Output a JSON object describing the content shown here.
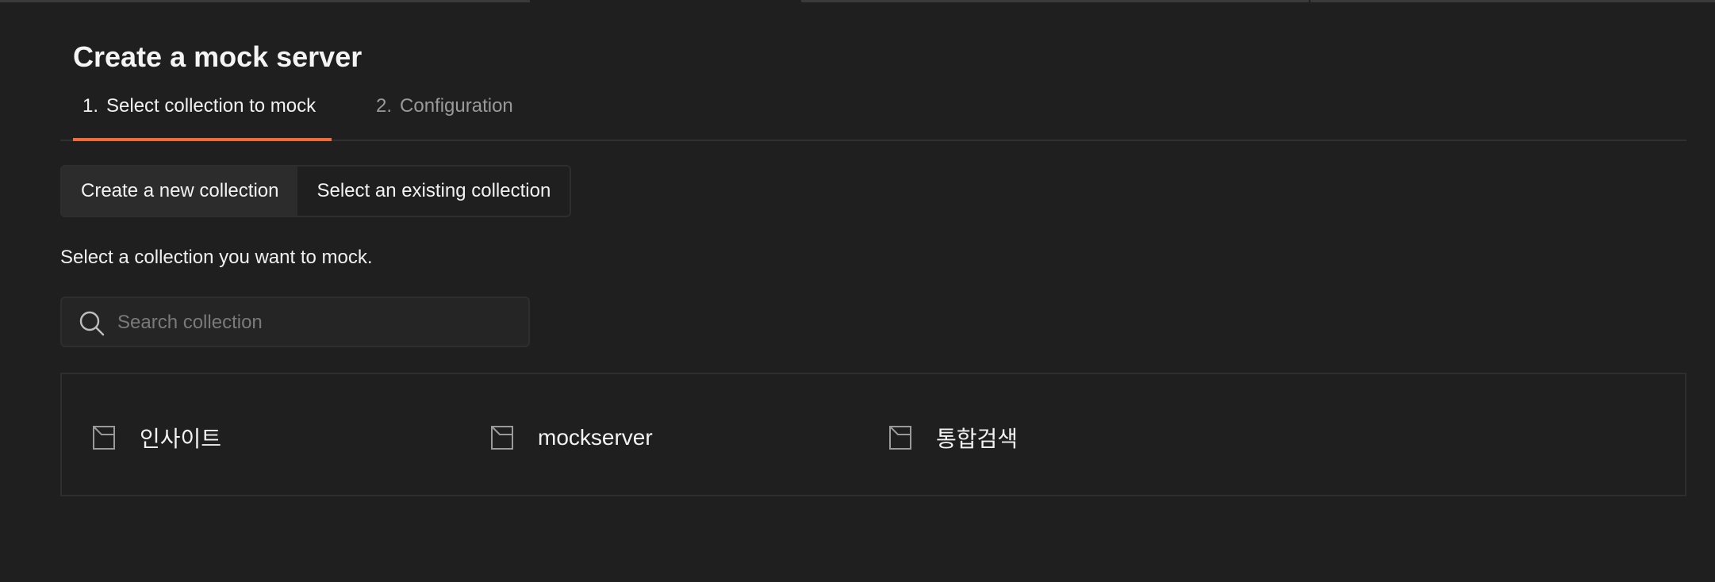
{
  "page": {
    "title": "Create a mock server"
  },
  "steps": [
    {
      "number": "1.",
      "label": "Select collection to mock",
      "active": true
    },
    {
      "number": "2.",
      "label": "Configuration",
      "active": false
    }
  ],
  "collection_mode": {
    "create_new_label": "Create a new collection",
    "select_existing_label": "Select an existing collection",
    "selected": "Create a new collection"
  },
  "instruction": "Select a collection you want to mock.",
  "search": {
    "placeholder": "Search collection",
    "value": ""
  },
  "collections": [
    {
      "name": "인사이트",
      "icon": "collection-icon"
    },
    {
      "name": "mockserver",
      "icon": "collection-icon"
    },
    {
      "name": "통합검색",
      "icon": "collection-icon"
    }
  ],
  "colors": {
    "background": "#1f1f1f",
    "accent": "#f26b3a",
    "text": "#f0f0f0",
    "muted_text": "#9a9a9a",
    "border": "#2e2e2e"
  }
}
